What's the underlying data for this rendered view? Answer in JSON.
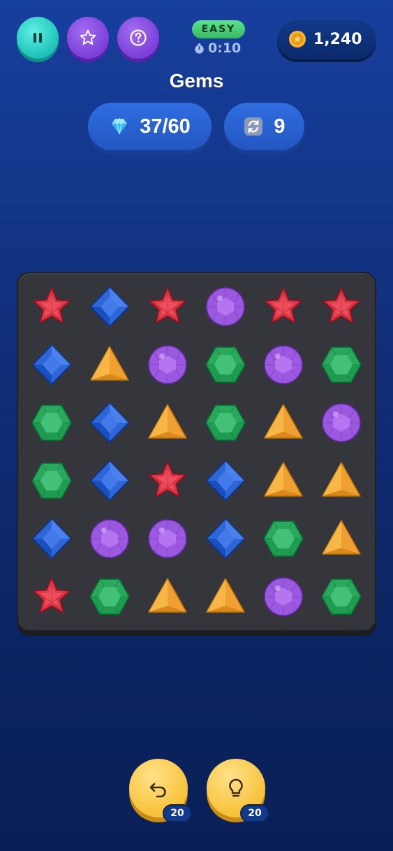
{
  "header": {
    "pause_icon": "pause-icon",
    "star_icon": "star-outline-icon",
    "help_icon": "question-icon",
    "difficulty": "EASY",
    "timer": "0:10",
    "coins": "1,240"
  },
  "title": "Gems",
  "stats": {
    "gems_collected": "37/60",
    "shuffles": "9"
  },
  "board": {
    "rows": 6,
    "cols": 6,
    "grid": [
      [
        "star",
        "diamond",
        "star",
        "orb",
        "star",
        "star"
      ],
      [
        "diamond",
        "pyramid",
        "orb",
        "emerald",
        "orb",
        "emerald"
      ],
      [
        "emerald",
        "diamond",
        "pyramid",
        "emerald",
        "pyramid",
        "orb"
      ],
      [
        "emerald",
        "diamond",
        "star",
        "diamond",
        "pyramid",
        "pyramid"
      ],
      [
        "diamond",
        "orb",
        "orb",
        "diamond",
        "emerald",
        "pyramid"
      ],
      [
        "star",
        "emerald",
        "pyramid",
        "pyramid",
        "orb",
        "emerald"
      ]
    ],
    "colors": {
      "star": "#d93a4a",
      "diamond": "#2f66d6",
      "orb": "#9b59e0",
      "emerald": "#2aa85e",
      "pyramid": "#f0a030"
    }
  },
  "actions": {
    "undo_count": "20",
    "hint_count": "20"
  }
}
